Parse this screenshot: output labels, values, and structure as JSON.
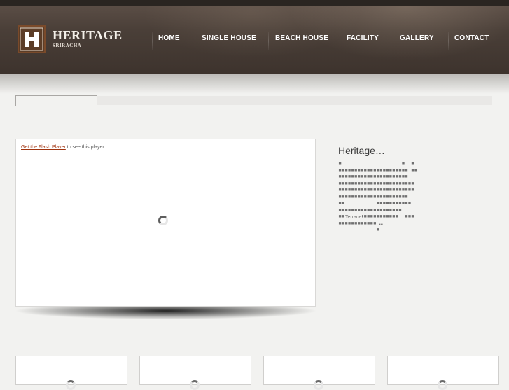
{
  "brand": {
    "name": "HERITAGE",
    "sub": "SRIRACHA",
    "logo_icon": "h-monogram-logo",
    "colors": {
      "logo_frame": "#7a4a2a",
      "logo_bg": "#5c3d27",
      "header": "#3d332d"
    }
  },
  "nav": {
    "items": [
      {
        "label": "HOME"
      },
      {
        "label": "SINGLE HOUSE"
      },
      {
        "label": "BEACH HOUSE"
      },
      {
        "label": "FACILITY"
      },
      {
        "label": "GALLERY"
      },
      {
        "label": "CONTACT"
      }
    ]
  },
  "player": {
    "link_text": "Get the Flash Player",
    "message": " to see this player.",
    "link_color": "#a03410",
    "loading_icon": "spinner-icon"
  },
  "side": {
    "title": "Heritage…",
    "body": "▪                   ▪  ▪\n▪▪▪▪▪▪▪▪▪▪▪▪▪▪▪▪▪▪▪▪▪▪ ▪▪\n▪▪▪▪▪▪▪▪▪▪▪▪▪▪▪▪▪▪▪▪▪▪\n▪▪▪▪▪▪▪▪▪▪▪▪▪▪▪▪▪▪▪▪▪▪▪▪\n▪▪▪▪▪▪▪▪▪▪▪▪▪▪▪▪▪▪▪▪▪▪▪▪\n▪▪▪▪▪▪▪▪▪▪▪▪▪▪▪▪▪▪▪▪▪▪\n▪▪          ▪▪▪▪▪▪▪▪▪▪▪\n▪▪▪▪▪▪▪▪▪▪▪▪▪▪▪▪▪▪▪▪\n▪▪▪▪▪▪▪▪▪▪▪▪▪▪▪▪▪▪▪  ▪▪▪\n▪▪▪▪▪▪▪▪▪▪▪▪ …\n            ▪",
    "terrace": "Terrace"
  },
  "thumbnails": [
    {
      "loading_icon": "spinner-icon"
    },
    {
      "loading_icon": "spinner-icon"
    },
    {
      "loading_icon": "spinner-icon"
    },
    {
      "loading_icon": "spinner-icon"
    }
  ]
}
